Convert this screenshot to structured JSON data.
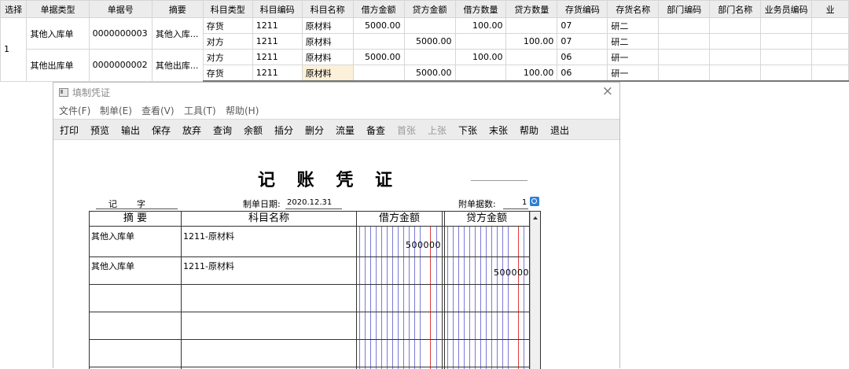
{
  "grid": {
    "headers": [
      "选择",
      "单据类型",
      "单据号",
      "摘要",
      "科目类型",
      "科目编码",
      "科目名称",
      "借方金额",
      "贷方金额",
      "借方数量",
      "贷方数量",
      "存货编码",
      "存货名称",
      "部门编码",
      "部门名称",
      "业务员编码",
      "业"
    ],
    "group_select": "1",
    "groups": [
      {
        "doc_type": "其他入库单",
        "doc_no": "0000000003",
        "summary": "其他入库...",
        "rows": [
          {
            "subj_type": "存货",
            "subj_code": "1211",
            "subj_name": "原材料",
            "debit": "",
            "credit": "",
            "debit_qty": "100.00",
            "credit_qty": "",
            "inv_code": "07",
            "inv_name": "研二"
          },
          {
            "subj_type": "对方",
            "subj_code": "1211",
            "subj_name": "原材料",
            "debit": "",
            "credit": "5000.00",
            "debit_qty": "",
            "credit_qty": "100.00",
            "inv_code": "07",
            "inv_name": "研二"
          }
        ]
      },
      {
        "doc_type": "其他出库单",
        "doc_no": "0000000002",
        "summary": "其他出库...",
        "rows": [
          {
            "subj_type": "对方",
            "subj_code": "1211",
            "subj_name": "原材料",
            "debit": "5000.00",
            "credit": "",
            "debit_qty": "100.00",
            "credit_qty": "",
            "inv_code": "06",
            "inv_name": "研一"
          },
          {
            "subj_type": "存货",
            "subj_code": "1211",
            "subj_name": "原材料",
            "debit": "",
            "credit": "5000.00",
            "debit_qty": "",
            "credit_qty": "100.00",
            "inv_code": "06",
            "inv_name": "研一"
          }
        ]
      }
    ],
    "row0_debit": "5000.00"
  },
  "dialog": {
    "title": "填制凭证",
    "close": "×",
    "menu": [
      "文件(F)",
      "制单(E)",
      "查看(V)",
      "工具(T)",
      "帮助(H)"
    ],
    "toolbar": [
      "打印",
      "预览",
      "输出",
      "保存",
      "放弃",
      "查询",
      "余额",
      "插分",
      "删分",
      "流量",
      "备查",
      "首张",
      "上张",
      "下张",
      "末张",
      "帮助",
      "退出"
    ],
    "toolbar_disabled": [
      "首张",
      "上张"
    ],
    "voucher_title": "记 账 凭 证",
    "type_label": "记",
    "type_suffix": "字",
    "date_label": "制单日期:",
    "date_value": "2020.12.31",
    "attach_label": "附单据数:",
    "attach_value": "1",
    "col_summary": "摘 要",
    "col_subject": "科目名称",
    "col_debit": "借方金额",
    "col_credit": "贷方金额",
    "entries": [
      {
        "summary": "其他入库单",
        "subject": "1211-原材料",
        "debit": "500000",
        "credit": ""
      },
      {
        "summary": "其他入库单",
        "subject": "1211-原材料",
        "debit": "",
        "credit": "500000"
      }
    ]
  },
  "colors": {
    "grid_header": "#ececec",
    "highlight": "#fdf0d8",
    "red_line": "#e03b3b",
    "blue_line": "#7a7ad8",
    "lookup": "#2f7fd6"
  }
}
